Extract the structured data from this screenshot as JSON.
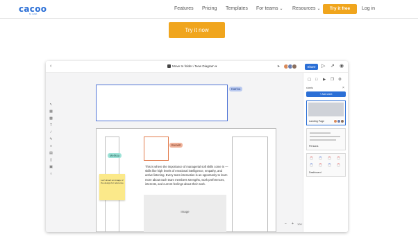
{
  "nav": {
    "logo": "cacoo",
    "logo_by": "by nulab",
    "items": [
      {
        "label": "Features",
        "dropdown": false
      },
      {
        "label": "Pricing",
        "dropdown": false
      },
      {
        "label": "Templates",
        "dropdown": false
      },
      {
        "label": "For teams",
        "dropdown": true
      },
      {
        "label": "Resources",
        "dropdown": true
      }
    ],
    "try_free": "Try it free",
    "login": "Log in"
  },
  "cta": {
    "label": "Try it now"
  },
  "app": {
    "breadcrumb": "Move to folder / New Diagram",
    "share_label": "Share",
    "avatar_colors": [
      "#d98a5a",
      "#6a7fb0",
      "#8a6f5e"
    ],
    "canvas": {
      "tag_katrina": "Katrina",
      "tag_melissa": "Melissa",
      "tag_burakit": "BurakIt",
      "sticky_note": "Let's insert an image of the design for reference",
      "paragraph": "This is where the importance of managerial soft skills come in — skills like high levels of emotional intelligence, empathy, and active listening. Every team interaction is an opportunity to learn more about each team members strengths, work preferences, interests, and current feelings about their work.",
      "image_label": "Image"
    },
    "zoom": "100 %",
    "panel": {
      "header": "sheets",
      "add_sheet": "+ Add sheet",
      "thumbs": [
        "Landing Page",
        "Persona",
        "Dashboard"
      ]
    }
  }
}
